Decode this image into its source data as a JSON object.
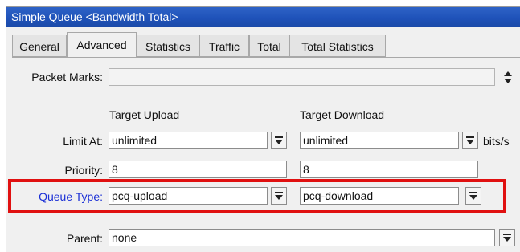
{
  "window": {
    "title": "Simple Queue <Bandwidth Total>"
  },
  "tabs": [
    {
      "label": "General",
      "active": false
    },
    {
      "label": "Advanced",
      "active": true
    },
    {
      "label": "Statistics",
      "active": false
    },
    {
      "label": "Traffic",
      "active": false
    },
    {
      "label": "Total",
      "active": false
    },
    {
      "label": "Total Statistics",
      "active": false
    }
  ],
  "form": {
    "packet_marks": {
      "label": "Packet Marks:",
      "value": ""
    },
    "columns": {
      "upload": "Target Upload",
      "download": "Target Download"
    },
    "limit_at": {
      "label": "Limit At:",
      "upload": "unlimited",
      "download": "unlimited",
      "unit": "bits/s"
    },
    "priority": {
      "label": "Priority:",
      "upload": "8",
      "download": "8"
    },
    "queue_type": {
      "label": "Queue Type:",
      "upload": "pcq-upload",
      "download": "pcq-download"
    },
    "parent": {
      "label": "Parent:",
      "value": "none"
    }
  },
  "colors": {
    "titlebar": "#1f52b9",
    "highlight_border": "#e01010",
    "queue_type_label": "#1a2fd6"
  },
  "icons": {
    "dropdown": "dropdown-arrow-icon",
    "updown": "up-down-arrows-icon"
  }
}
